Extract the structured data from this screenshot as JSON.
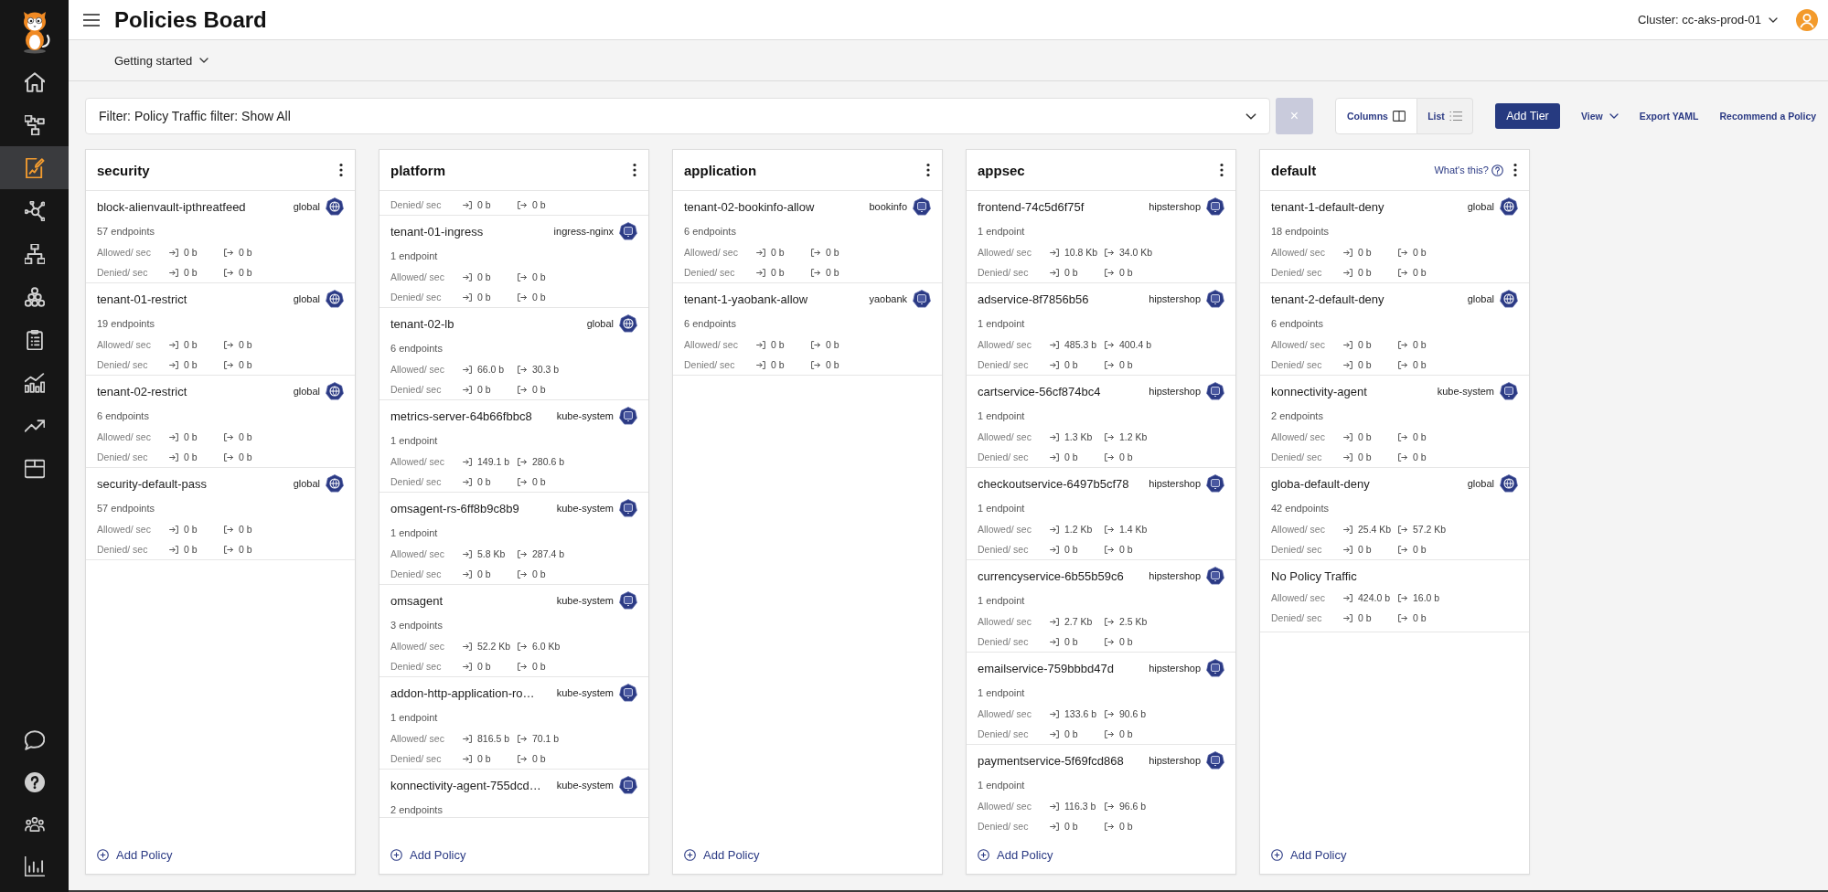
{
  "sidebar": {
    "items": [
      {
        "selected": false
      },
      {
        "selected": false
      },
      {
        "selected": true
      },
      {
        "selected": false
      },
      {
        "selected": false
      },
      {
        "selected": false
      },
      {
        "selected": false
      },
      {
        "selected": false
      },
      {
        "selected": false
      },
      {
        "selected": false
      }
    ]
  },
  "header": {
    "title": "Policies Board",
    "cluster": "Cluster: cc-aks-prod-01"
  },
  "subbar": {
    "menu": "Getting started"
  },
  "toolbar": {
    "filter": {
      "value": "Filter: Policy Traffic filter: Show All"
    },
    "clear_button": {
      "label": "×",
      "disabled": true
    },
    "views": [
      {
        "label": "Columns",
        "selected": true
      },
      {
        "label": "List",
        "selected": false
      }
    ],
    "add_tier": "Add Tier",
    "actions": [
      {
        "label": "View",
        "kind": "menu"
      },
      {
        "label": "Export YAML",
        "kind": "link"
      },
      {
        "label": "Recommend a Policy",
        "kind": "link"
      }
    ]
  },
  "tiers": [
    {
      "name": "security",
      "add_label": "Add Policy",
      "policies": [
        {
          "kind": "global",
          "name": "block-alienvault-ipthreatfeed",
          "namespace": "global",
          "endpoints": "57 endpoints",
          "stats": [
            {
              "label": "Allowed/ sec",
              "in": "0 b",
              "out": "0 b"
            },
            {
              "label": "Denied/ sec",
              "in": "0 b",
              "out": "0 b"
            }
          ]
        },
        {
          "kind": "global",
          "name": "tenant-01-restrict",
          "namespace": "global",
          "endpoints": "19 endpoints",
          "stats": [
            {
              "label": "Allowed/ sec",
              "in": "0 b",
              "out": "0 b"
            },
            {
              "label": "Denied/ sec",
              "in": "0 b",
              "out": "0 b"
            }
          ]
        },
        {
          "kind": "global",
          "name": "tenant-02-restrict",
          "namespace": "global",
          "endpoints": "6 endpoints",
          "stats": [
            {
              "label": "Allowed/ sec",
              "in": "0 b",
              "out": "0 b"
            },
            {
              "label": "Denied/ sec",
              "in": "0 b",
              "out": "0 b"
            }
          ]
        },
        {
          "kind": "global",
          "name": "security-default-pass",
          "namespace": "global",
          "endpoints": "57 endpoints",
          "stats": [
            {
              "label": "Allowed/ sec",
              "in": "0 b",
              "out": "0 b"
            },
            {
              "label": "Denied/ sec",
              "in": "0 b",
              "out": "0 b"
            }
          ]
        }
      ]
    },
    {
      "name": "platform",
      "add_label": "Add Policy",
      "policies": [
        {
          "kind": "cut",
          "stats": [
            {
              "label": "Denied/ sec",
              "in": "0 b",
              "out": "0 b"
            }
          ]
        },
        {
          "kind": "namespaced",
          "name": "tenant-01-ingress",
          "namespace": "ingress-nginx",
          "endpoints": "1 endpoint",
          "stats": [
            {
              "label": "Allowed/ sec",
              "in": "0 b",
              "out": "0 b"
            },
            {
              "label": "Denied/ sec",
              "in": "0 b",
              "out": "0 b"
            }
          ]
        },
        {
          "kind": "global",
          "name": "tenant-02-lb",
          "namespace": "global",
          "endpoints": "6 endpoints",
          "stats": [
            {
              "label": "Allowed/ sec",
              "in": "66.0 b",
              "out": "30.3 b"
            },
            {
              "label": "Denied/ sec",
              "in": "0 b",
              "out": "0 b"
            }
          ]
        },
        {
          "kind": "namespaced",
          "name": "metrics-server-64b66fbbc8",
          "namespace": "kube-system",
          "endpoints": "1 endpoint",
          "stats": [
            {
              "label": "Allowed/ sec",
              "in": "149.1 b",
              "out": "280.6 b"
            },
            {
              "label": "Denied/ sec",
              "in": "0 b",
              "out": "0 b"
            }
          ]
        },
        {
          "kind": "namespaced",
          "name": "omsagent-rs-6ff8b9c8b9",
          "namespace": "kube-system",
          "endpoints": "1 endpoint",
          "stats": [
            {
              "label": "Allowed/ sec",
              "in": "5.8 Kb",
              "out": "287.4 b"
            },
            {
              "label": "Denied/ sec",
              "in": "0 b",
              "out": "0 b"
            }
          ]
        },
        {
          "kind": "namespaced",
          "name": "omsagent",
          "namespace": "kube-system",
          "endpoints": "3 endpoints",
          "stats": [
            {
              "label": "Allowed/ sec",
              "in": "52.2 Kb",
              "out": "6.0 Kb"
            },
            {
              "label": "Denied/ sec",
              "in": "0 b",
              "out": "0 b"
            }
          ]
        },
        {
          "kind": "namespaced",
          "name": "addon-http-application-ro…",
          "namespace": "kube-system",
          "endpoints": "1 endpoint",
          "stats": [
            {
              "label": "Allowed/ sec",
              "in": "816.5 b",
              "out": "70.1 b"
            },
            {
              "label": "Denied/ sec",
              "in": "0 b",
              "out": "0 b"
            }
          ]
        },
        {
          "kind": "namespaced",
          "name": "konnectivity-agent-755dcd…",
          "namespace": "kube-system",
          "endpoints": "2 endpoints"
        }
      ]
    },
    {
      "name": "application",
      "add_label": "Add Policy",
      "policies": [
        {
          "kind": "namespaced",
          "name": "tenant-02-bookinfo-allow",
          "namespace": "bookinfo",
          "endpoints": "6 endpoints",
          "stats": [
            {
              "label": "Allowed/ sec",
              "in": "0 b",
              "out": "0 b"
            },
            {
              "label": "Denied/ sec",
              "in": "0 b",
              "out": "0 b"
            }
          ]
        },
        {
          "kind": "namespaced",
          "name": "tenant-1-yaobank-allow",
          "namespace": "yaobank",
          "endpoints": "6 endpoints",
          "stats": [
            {
              "label": "Allowed/ sec",
              "in": "0 b",
              "out": "0 b"
            },
            {
              "label": "Denied/ sec",
              "in": "0 b",
              "out": "0 b"
            }
          ]
        }
      ]
    },
    {
      "name": "appsec",
      "add_label": "Add Policy",
      "policies": [
        {
          "kind": "namespaced",
          "name": "frontend-74c5d6f75f",
          "namespace": "hipstershop",
          "endpoints": "1 endpoint",
          "stats": [
            {
              "label": "Allowed/ sec",
              "in": "10.8 Kb",
              "out": "34.0 Kb"
            },
            {
              "label": "Denied/ sec",
              "in": "0 b",
              "out": "0 b"
            }
          ]
        },
        {
          "kind": "namespaced",
          "name": "adservice-8f7856b56",
          "namespace": "hipstershop",
          "endpoints": "1 endpoint",
          "stats": [
            {
              "label": "Allowed/ sec",
              "in": "485.3 b",
              "out": "400.4 b"
            },
            {
              "label": "Denied/ sec",
              "in": "0 b",
              "out": "0 b"
            }
          ]
        },
        {
          "kind": "namespaced",
          "name": "cartservice-56cf874bc4",
          "namespace": "hipstershop",
          "endpoints": "1 endpoint",
          "stats": [
            {
              "label": "Allowed/ sec",
              "in": "1.3 Kb",
              "out": "1.2 Kb"
            },
            {
              "label": "Denied/ sec",
              "in": "0 b",
              "out": "0 b"
            }
          ]
        },
        {
          "kind": "namespaced",
          "name": "checkoutservice-6497b5cf78",
          "namespace": "hipstershop",
          "endpoints": "1 endpoint",
          "stats": [
            {
              "label": "Allowed/ sec",
              "in": "1.2 Kb",
              "out": "1.4 Kb"
            },
            {
              "label": "Denied/ sec",
              "in": "0 b",
              "out": "0 b"
            }
          ]
        },
        {
          "kind": "namespaced",
          "name": "currencyservice-6b55b59c6",
          "namespace": "hipstershop",
          "endpoints": "1 endpoint",
          "stats": [
            {
              "label": "Allowed/ sec",
              "in": "2.7 Kb",
              "out": "2.5 Kb"
            },
            {
              "label": "Denied/ sec",
              "in": "0 b",
              "out": "0 b"
            }
          ]
        },
        {
          "kind": "namespaced",
          "name": "emailservice-759bbbd47d",
          "namespace": "hipstershop",
          "endpoints": "1 endpoint",
          "stats": [
            {
              "label": "Allowed/ sec",
              "in": "133.6 b",
              "out": "90.6 b"
            },
            {
              "label": "Denied/ sec",
              "in": "0 b",
              "out": "0 b"
            }
          ]
        },
        {
          "kind": "namespaced",
          "name": "paymentservice-5f69fcd868",
          "namespace": "hipstershop",
          "endpoints": "1 endpoint",
          "stats": [
            {
              "label": "Allowed/ sec",
              "in": "116.3 b",
              "out": "96.6 b"
            },
            {
              "label": "Denied/ sec",
              "in": "0 b",
              "out": "0 b"
            }
          ]
        }
      ]
    },
    {
      "name": "default",
      "help": "What's this?",
      "add_label": "Add Policy",
      "policies": [
        {
          "kind": "global",
          "name": "tenant-1-default-deny",
          "namespace": "global",
          "endpoints": "18 endpoints",
          "stats": [
            {
              "label": "Allowed/ sec",
              "in": "0 b",
              "out": "0 b"
            },
            {
              "label": "Denied/ sec",
              "in": "0 b",
              "out": "0 b"
            }
          ]
        },
        {
          "kind": "global",
          "name": "tenant-2-default-deny",
          "namespace": "global",
          "endpoints": "6 endpoints",
          "stats": [
            {
              "label": "Allowed/ sec",
              "in": "0 b",
              "out": "0 b"
            },
            {
              "label": "Denied/ sec",
              "in": "0 b",
              "out": "0 b"
            }
          ]
        },
        {
          "kind": "namespaced",
          "name": "konnectivity-agent",
          "namespace": "kube-system",
          "endpoints": "2 endpoints",
          "stats": [
            {
              "label": "Allowed/ sec",
              "in": "0 b",
              "out": "0 b"
            },
            {
              "label": "Denied/ sec",
              "in": "0 b",
              "out": "0 b"
            }
          ]
        },
        {
          "kind": "global",
          "name": "globa-default-deny",
          "namespace": "global",
          "endpoints": "42 endpoints",
          "stats": [
            {
              "label": "Allowed/ sec",
              "in": "25.4 Kb",
              "out": "57.2 Kb"
            },
            {
              "label": "Denied/ sec",
              "in": "0 b",
              "out": "0 b"
            }
          ]
        },
        {
          "kind": "plain",
          "name": "No Policy Traffic",
          "stats": [
            {
              "label": "Allowed/ sec",
              "in": "424.0 b",
              "out": "16.0 b"
            },
            {
              "label": "Denied/ sec",
              "in": "0 b",
              "out": "0 b"
            }
          ]
        }
      ]
    }
  ]
}
